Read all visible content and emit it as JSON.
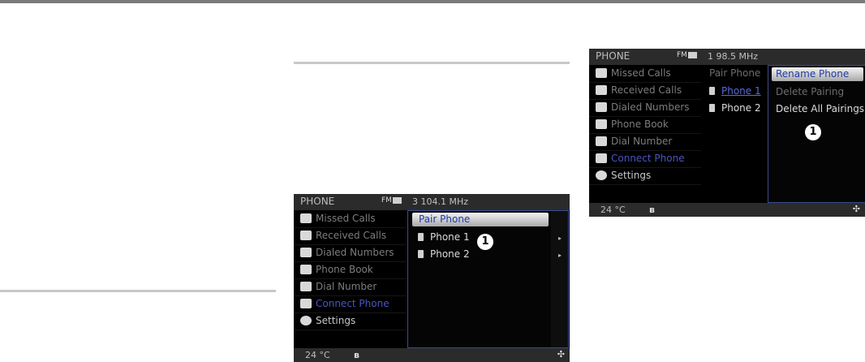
{
  "screens": [
    {
      "header": {
        "title": "PHONE",
        "fm": "FM",
        "radio": "3  104.1 MHz"
      },
      "menu": [
        {
          "label": "Missed Calls",
          "icon": "missed-calls-icon"
        },
        {
          "label": "Received Calls",
          "icon": "received-calls-icon"
        },
        {
          "label": "Dialed Numbers",
          "icon": "dialed-numbers-icon"
        },
        {
          "label": "Phone Book",
          "icon": "phone-book-icon"
        },
        {
          "label": "Dial Number",
          "icon": "dial-number-icon"
        },
        {
          "label": "Connect Phone",
          "icon": "connect-phone-icon",
          "state": "selected"
        },
        {
          "label": "Settings",
          "icon": "settings-icon"
        }
      ],
      "panel": {
        "highlight": "Pair Phone",
        "items": [
          "Phone 1",
          "Phone 2"
        ]
      },
      "badge": "1",
      "footer": {
        "temp": "24 °C",
        "bluetooth": "bluetooth-icon",
        "nav": "nav-icon"
      }
    },
    {
      "header": {
        "title": "PHONE",
        "fm": "FM",
        "radio": "1   98.5 MHz"
      },
      "menu": [
        {
          "label": "Missed Calls",
          "icon": "missed-calls-icon"
        },
        {
          "label": "Received Calls",
          "icon": "received-calls-icon"
        },
        {
          "label": "Dialed Numbers",
          "icon": "dialed-numbers-icon"
        },
        {
          "label": "Phone Book",
          "icon": "phone-book-icon"
        },
        {
          "label": "Dial Number",
          "icon": "dial-number-icon"
        },
        {
          "label": "Connect Phone",
          "icon": "connect-phone-icon",
          "state": "selected"
        },
        {
          "label": "Settings",
          "icon": "settings-icon"
        }
      ],
      "middle": {
        "title": "Pair Phone",
        "items": [
          "Phone 1",
          "Phone 2"
        ]
      },
      "submenu": {
        "highlight": "Rename Phone",
        "items": [
          "Delete Pairing",
          "Delete All Pairings"
        ]
      },
      "badge": "1",
      "footer": {
        "temp": "24 °C",
        "bluetooth": "bluetooth-icon",
        "nav": "nav-icon"
      }
    }
  ],
  "glyphs": {
    "bluetooth": "ʙ",
    "nav": "✣",
    "arrow": "▸"
  }
}
